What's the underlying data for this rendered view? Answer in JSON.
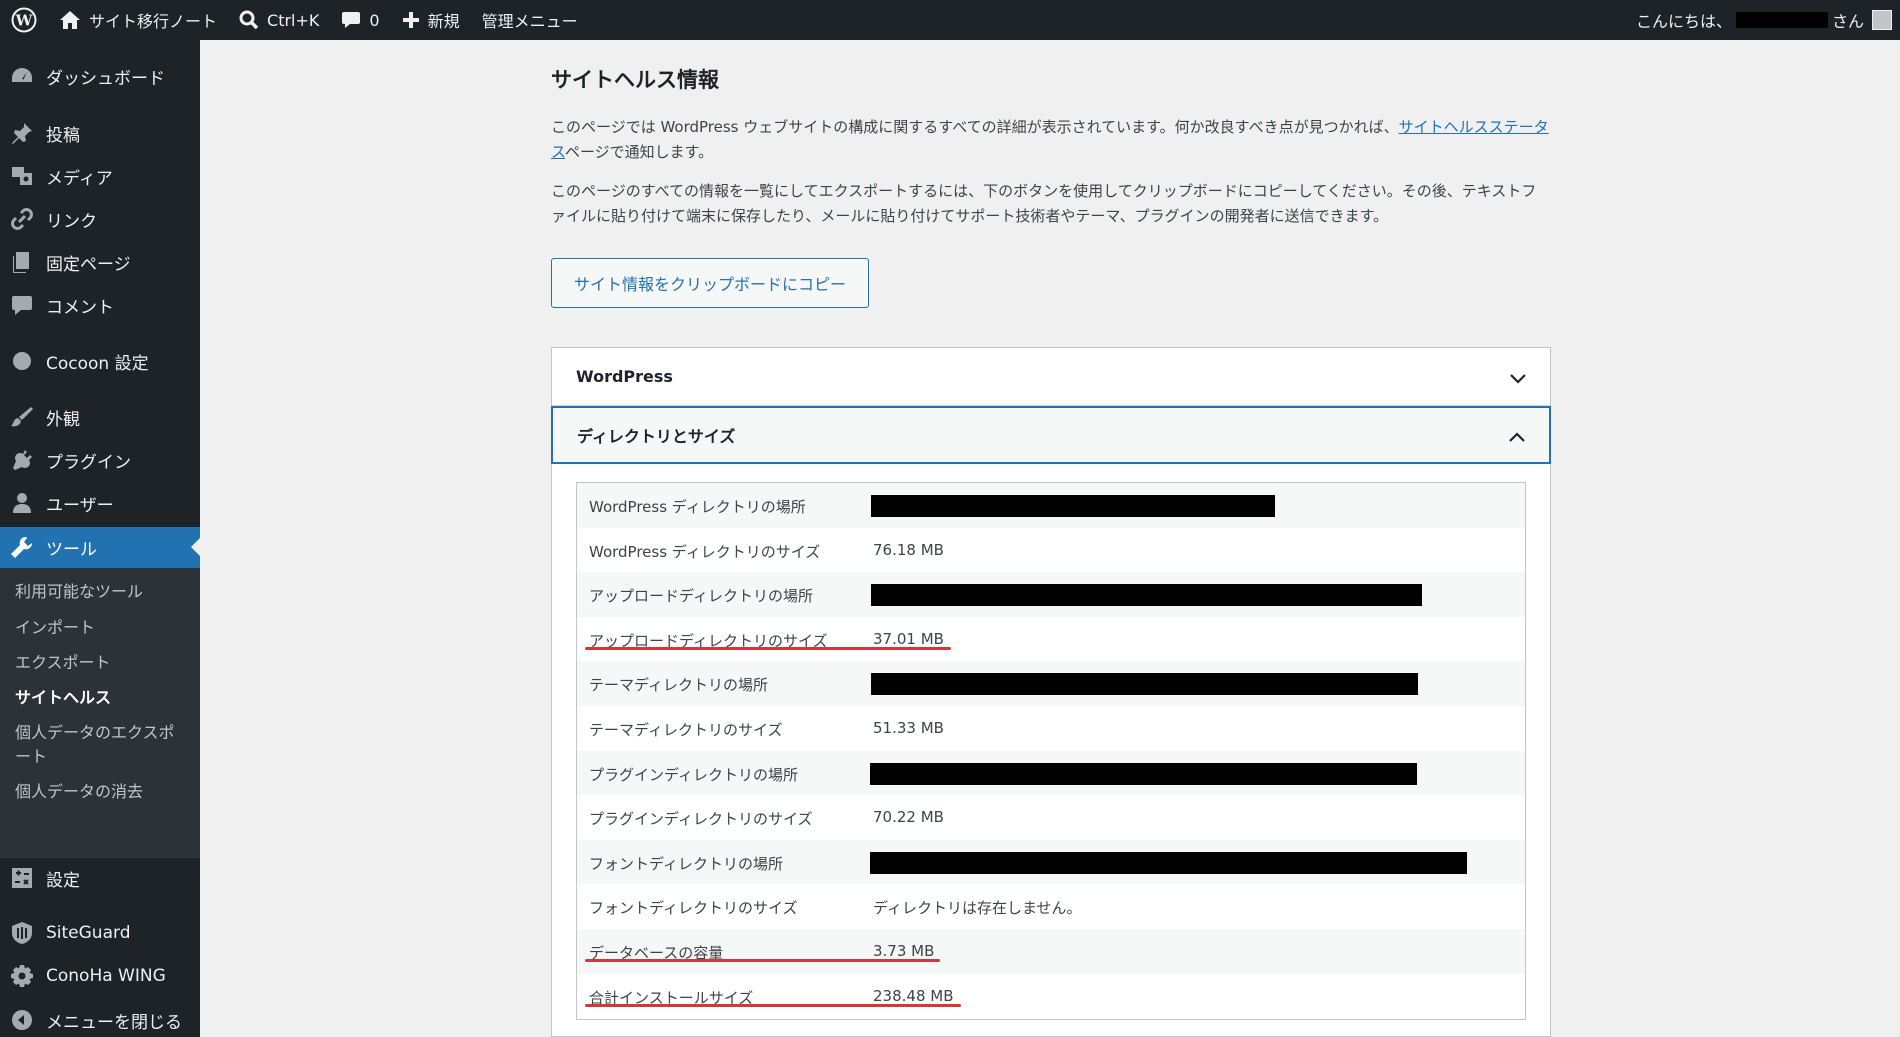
{
  "adminbar": {
    "site_name": "サイト移行ノート",
    "search_shortcut": "Ctrl+K",
    "comment_count": "0",
    "new_label": "新規",
    "admin_menu_label": "管理メニュー",
    "greeting_prefix": "こんにちは、",
    "greeting_suffix": "さん"
  },
  "sidebar": {
    "items": [
      {
        "label": "ダッシュボード",
        "icon": "dashboard-icon"
      },
      {
        "label": "投稿",
        "icon": "pin-icon"
      },
      {
        "label": "メディア",
        "icon": "media-icon"
      },
      {
        "label": "リンク",
        "icon": "link-icon"
      },
      {
        "label": "固定ページ",
        "icon": "page-icon"
      },
      {
        "label": "コメント",
        "icon": "comment-icon"
      },
      {
        "label": "Cocoon 設定",
        "icon": "cocoon-icon"
      },
      {
        "label": "外観",
        "icon": "brush-icon"
      },
      {
        "label": "プラグイン",
        "icon": "plugin-icon"
      },
      {
        "label": "ユーザー",
        "icon": "user-icon"
      },
      {
        "label": "ツール",
        "icon": "wrench-icon"
      },
      {
        "label": "設定",
        "icon": "settings-icon"
      },
      {
        "label": "SiteGuard",
        "icon": "siteguard-icon"
      },
      {
        "label": "ConoHa WING",
        "icon": "gear-icon"
      },
      {
        "label": "メニューを閉じる",
        "icon": "collapse-icon"
      }
    ],
    "submenu": [
      "利用可能なツール",
      "インポート",
      "エクスポート",
      "サイトヘルス",
      "個人データのエクスポート",
      "個人データの消去"
    ]
  },
  "main": {
    "title": "サイトヘルス情報",
    "desc1_text": "このページでは WordPress ウェブサイトの構成に関するすべての詳細が表示されています。何か改良すべき点が見つかれば、",
    "desc1_link": "サイトヘルスステータス",
    "desc1_end": "ページで通知します。",
    "desc2": "このページのすべての情報を一覧にしてエクスポートするには、下のボタンを使用してクリップボードにコピーしてください。その後、テキストファイルに貼り付けて端末に保存したり、メールに貼り付けてサポート技術者やテーマ、プラグインの開発者に送信できます。",
    "copy_button": "サイト情報をクリップボードにコピー",
    "accordion_wordpress": "WordPress",
    "accordion_directories": "ディレクトリとサイズ",
    "rows": [
      {
        "label": "WordPress ディレクトリの場所",
        "value": ""
      },
      {
        "label": "WordPress ディレクトリのサイズ",
        "value": "76.18 MB"
      },
      {
        "label": "アップロードディレクトリの場所",
        "value": ""
      },
      {
        "label": "アップロードディレクトリのサイズ",
        "value": "37.01 MB"
      },
      {
        "label": "テーマディレクトリの場所",
        "value": ""
      },
      {
        "label": "テーマディレクトリのサイズ",
        "value": "51.33 MB"
      },
      {
        "label": "プラグインディレクトリの場所",
        "value": ""
      },
      {
        "label": "プラグインディレクトリのサイズ",
        "value": "70.22 MB"
      },
      {
        "label": "フォントディレクトリの場所",
        "value": ""
      },
      {
        "label": "フォントディレクトリのサイズ",
        "value": "ディレクトリは存在しません。"
      },
      {
        "label": "データベースの容量",
        "value": "3.73 MB"
      },
      {
        "label": "合計インストールサイズ",
        "value": "238.48 MB"
      }
    ]
  },
  "colors": {
    "accent": "#2271b1",
    "sidebar": "#1d2327",
    "highlight": "#d63638"
  }
}
